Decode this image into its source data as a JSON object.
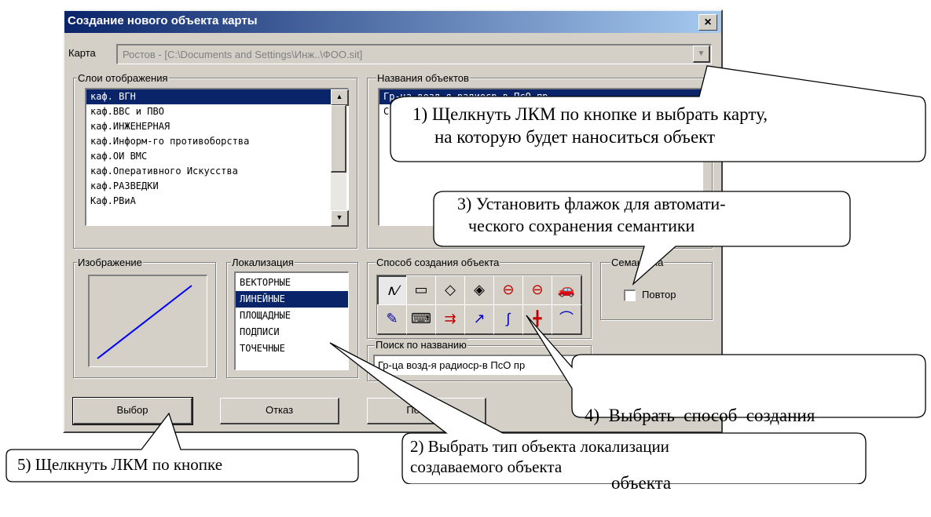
{
  "dialog": {
    "title": "Создание нового объекта карты",
    "close_label": "×",
    "map_label": "Карта",
    "map_value": "Ростов - [C:\\Documents and Settings\\Инж..\\ФОО.sit]",
    "layers": {
      "title": "Слои отображения",
      "items": [
        "каф. ВГН",
        "каф.ВВС и ПВО",
        "каф.ИНЖЕНЕРНАЯ",
        "каф.Информ-го противоборства",
        "каф.ОИ ВМС",
        "каф.Оперативного Искусства",
        "каф.РАЗВЕДКИ",
        "Каф.РВиА"
      ]
    },
    "object_names": {
      "title": "Названия объектов",
      "item1": "Гр-ца возд-я радиоср-в ПсО пр",
      "item2": "С"
    },
    "image_title": "Изображение",
    "localization": {
      "title": "Локализация",
      "items": [
        "ВЕКТОРНЫЕ",
        "ЛИНЕЙНЫЕ",
        "ПЛОЩАДНЫЕ",
        "ПОДПИСИ",
        "ТОЧЕЧНЫЕ"
      ]
    },
    "method_title": "Способ создания объекта",
    "semantics_title": "Семантика",
    "repeat_label": "Повтор",
    "search_title": "Поиск  по названию",
    "search_value": "Гр-ца возд-я радиоср-в ПсО пр",
    "buttons": {
      "select": "Выбор",
      "cancel": "Отказ",
      "help": "Помощь"
    }
  },
  "callouts": {
    "c1_line1": "1) Щелкнуть ЛКМ по кнопке и выбрать карту,",
    "c1_line2": "на которую будет наноситься объект",
    "c2_line1": "2) Выбрать тип объекта локализации",
    "c2_line2": "создаваемого объекта",
    "c3_line1": "3) Установить флажок для автомати-",
    "c3_line2": "ческого  сохранения семантики",
    "c4_line1": "4)  Выбрать  способ  создания",
    "c4_line2": "объекта",
    "c5": "5) Щелкнуть ЛКМ по кнопке"
  },
  "colors": {
    "title_bar": "#0a246a",
    "selection": "#0a246a",
    "dialog_face": "#d4d0c8",
    "preview_line": "#0000ff"
  }
}
